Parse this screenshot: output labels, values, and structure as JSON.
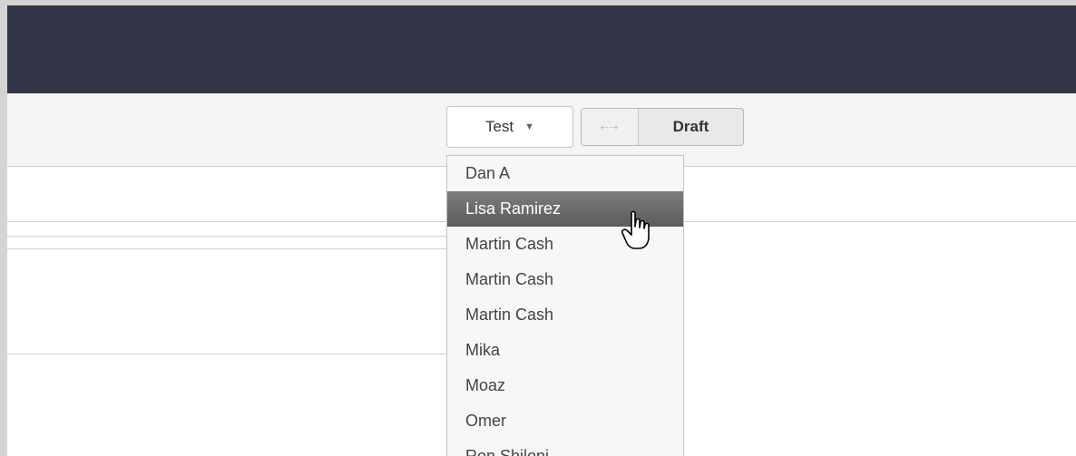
{
  "toolbar": {
    "environment_select": {
      "value": "Test",
      "arrow_icon": "caret-down-icon"
    },
    "mode_toggle": {
      "swap_icon": "swap-arrows-icon",
      "label": "Draft"
    }
  },
  "dropdown": {
    "items": [
      {
        "label": "Dan A",
        "active": false
      },
      {
        "label": "Lisa Ramirez",
        "active": true
      },
      {
        "label": "Martin Cash",
        "active": false
      },
      {
        "label": "Martin Cash",
        "active": false
      },
      {
        "label": "Martin Cash",
        "active": false
      },
      {
        "label": "Mika",
        "active": false
      },
      {
        "label": "Moaz",
        "active": false
      },
      {
        "label": "Omer",
        "active": false
      },
      {
        "label": "Ron Shiloni",
        "active": false
      }
    ]
  },
  "cursor": {
    "icon": "hand-pointer-icon"
  },
  "colors": {
    "header": "#323646",
    "toolbar": "#f4f4f4",
    "active_item": "#6b6b6b"
  }
}
